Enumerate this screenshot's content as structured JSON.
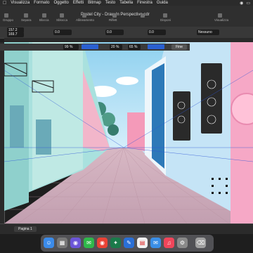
{
  "menubar": {
    "items": [
      "Visualizza",
      "Formato",
      "Oggetto",
      "Effetti",
      "Bitmap",
      "Testo",
      "Tabella",
      "Finestra",
      "Guida"
    ]
  },
  "window": {
    "title": "Pastel City - Draw In Perspective.cdr"
  },
  "toolbar": {
    "labels": [
      "Gruppo",
      "Separa",
      "Blocca",
      "Sblocca",
      "Allineamento",
      "Riflett",
      "Disponi",
      "Visualizza"
    ],
    "zoom_value": "0.0",
    "position_x": "0.0",
    "rotation": "0.0",
    "outline_style": "Nessuno",
    "width_x": "157.2",
    "width_y": "169.7"
  },
  "props": {
    "opacity_1": "99 %",
    "opacity_2": "20 %",
    "opacity_3": "65 %",
    "fine_label": "Fine"
  },
  "status": {
    "page_tab": "Pagina 1"
  },
  "dock": {
    "apps": [
      "finder-icon",
      "launchpad-icon",
      "siri-icon",
      "messages-icon",
      "chrome-icon",
      "coreldraw-icon",
      "canvas-icon",
      "calendar-icon",
      "mail-icon",
      "music-icon",
      "settings-icon",
      "trash-icon"
    ]
  },
  "colors": {
    "accent": "#2a5fd0",
    "sky": "#9fd6f0",
    "left_building": "#a9e1de",
    "right_building": "#b9ddf1",
    "pink_wall": "#f4a7c4",
    "street": "#c7a7b1"
  }
}
